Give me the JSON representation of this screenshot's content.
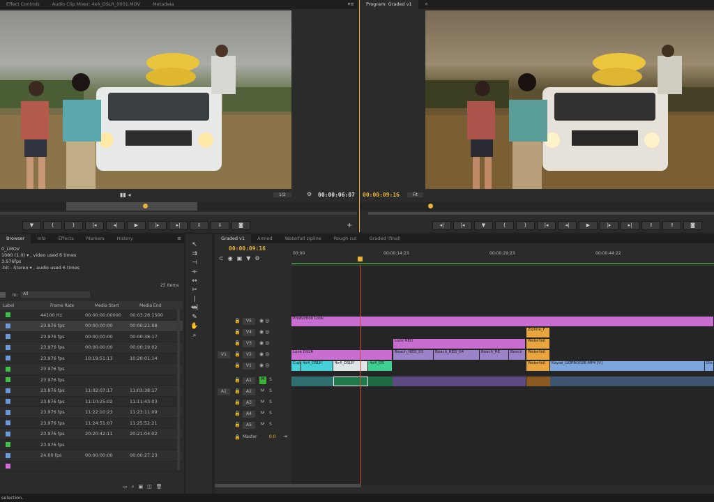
{
  "source_monitor": {
    "tabs": [
      "Effect Controls",
      "Audio Clip Mixer: 4x4_DSLR_0001.MOV",
      "Metadata"
    ],
    "timecode": "00:00:06:07",
    "zoom_value": "1/2",
    "menu_icon": "panel-menu-icon"
  },
  "program_monitor": {
    "tabs": [
      "Program: Graded v1"
    ],
    "timecode": "00:00:09:16",
    "zoom_value": "Fit"
  },
  "project_panel": {
    "tabs": [
      "Browser",
      "Info",
      "Effects",
      "Markers",
      "History"
    ],
    "clip_name": "0_LMOV",
    "info_lines": [
      "1080 (1.0) ▾ , video used 6 times",
      "3.976fps",
      "-bit - Stereo ▾ , audio used 6 times"
    ],
    "item_count": "25 Items",
    "in_label": "In:",
    "in_value": "All",
    "columns": [
      "Label",
      "Frame Rate",
      "Media Start",
      "Media End"
    ],
    "rows": [
      {
        "color": "#3fc14a",
        "rate": "44100 Hz",
        "start": "00:00:00:00000",
        "end": "00:03:28:1500"
      },
      {
        "color": "#6a9bd8",
        "rate": "23.976 fps",
        "start": "00:00:00:00",
        "end": "00:00:21:08"
      },
      {
        "color": "#6a9bd8",
        "rate": "23.976 fps",
        "start": "00:00:00:00",
        "end": "00:00:38:17"
      },
      {
        "color": "#6a9bd8",
        "rate": "23.976 fps",
        "start": "00:00:00:00",
        "end": "00:00:19:02"
      },
      {
        "color": "#6a9bd8",
        "rate": "23.976 fps",
        "start": "10:19:51:13",
        "end": "10:20:01:14"
      },
      {
        "color": "#3fc14a",
        "rate": "23.976 fps",
        "start": "",
        "end": ""
      },
      {
        "color": "#3fc14a",
        "rate": "23.976 fps",
        "start": "",
        "end": ""
      },
      {
        "color": "#6a9bd8",
        "rate": "23.976 fps",
        "start": "11:02:07:17",
        "end": "11:03:38:17"
      },
      {
        "color": "#6a9bd8",
        "rate": "23.976 fps",
        "start": "11:10:25:02",
        "end": "11:11:43:03"
      },
      {
        "color": "#6a9bd8",
        "rate": "23.976 fps",
        "start": "11:22:10:23",
        "end": "11:23:11:09"
      },
      {
        "color": "#6a9bd8",
        "rate": "23.976 fps",
        "start": "11:24:51:07",
        "end": "11:25:52:21"
      },
      {
        "color": "#6a9bd8",
        "rate": "23.976 fps",
        "start": "20:20:42:11",
        "end": "20:21:04:02"
      },
      {
        "color": "#3fc14a",
        "rate": "23.976 fps",
        "start": "",
        "end": ""
      },
      {
        "color": "#6a9bd8",
        "rate": "24.00 fps",
        "start": "00:00:00:00",
        "end": "00:00:27:23"
      },
      {
        "color": "#d36ad8",
        "rate": "",
        "start": "",
        "end": ""
      }
    ]
  },
  "timeline": {
    "tabs": [
      "Graded v1",
      "Armed",
      "Waterfall zipline",
      "Rough cut",
      "Graded (final)"
    ],
    "timecode": "00:00:09:16",
    "ruler": [
      "00:00",
      "00:00:14:23",
      "00:00:29:23",
      "00:00:44:22"
    ],
    "video_tracks": [
      "V5",
      "V4",
      "V3",
      "V2",
      "V1"
    ],
    "audio_tracks": [
      "A1",
      "A2",
      "A3",
      "A4",
      "A5"
    ],
    "source_v": "V1",
    "source_a": "A1",
    "master_label": "Master",
    "master_value": "0.0",
    "clips": {
      "production_look": "Production Look",
      "zipline": "Zipline_F",
      "waterfall_v3": "Waterfall",
      "look_red": "Look RED",
      "look_dslr": "Look DSLR",
      "beach_red_1": "Beach_RED_03",
      "beach_red_2": "Beach_RED_04",
      "beach_red_3": "Beach_RE",
      "beach_4": "Beach",
      "waterfall_v2": "Waterfall",
      "cup": "Cup",
      "four_dslr_1": "4x4_DSLR",
      "four_dslr_2": "4x4_DSLR",
      "four_dslr_3": "4x4_DS",
      "waterfall_v1": "Waterfall",
      "kayak": "Kayak_GOPRO026.MP4 [V]",
      "end_clip": "Dis"
    }
  },
  "status_bar": {
    "text": "selection."
  }
}
